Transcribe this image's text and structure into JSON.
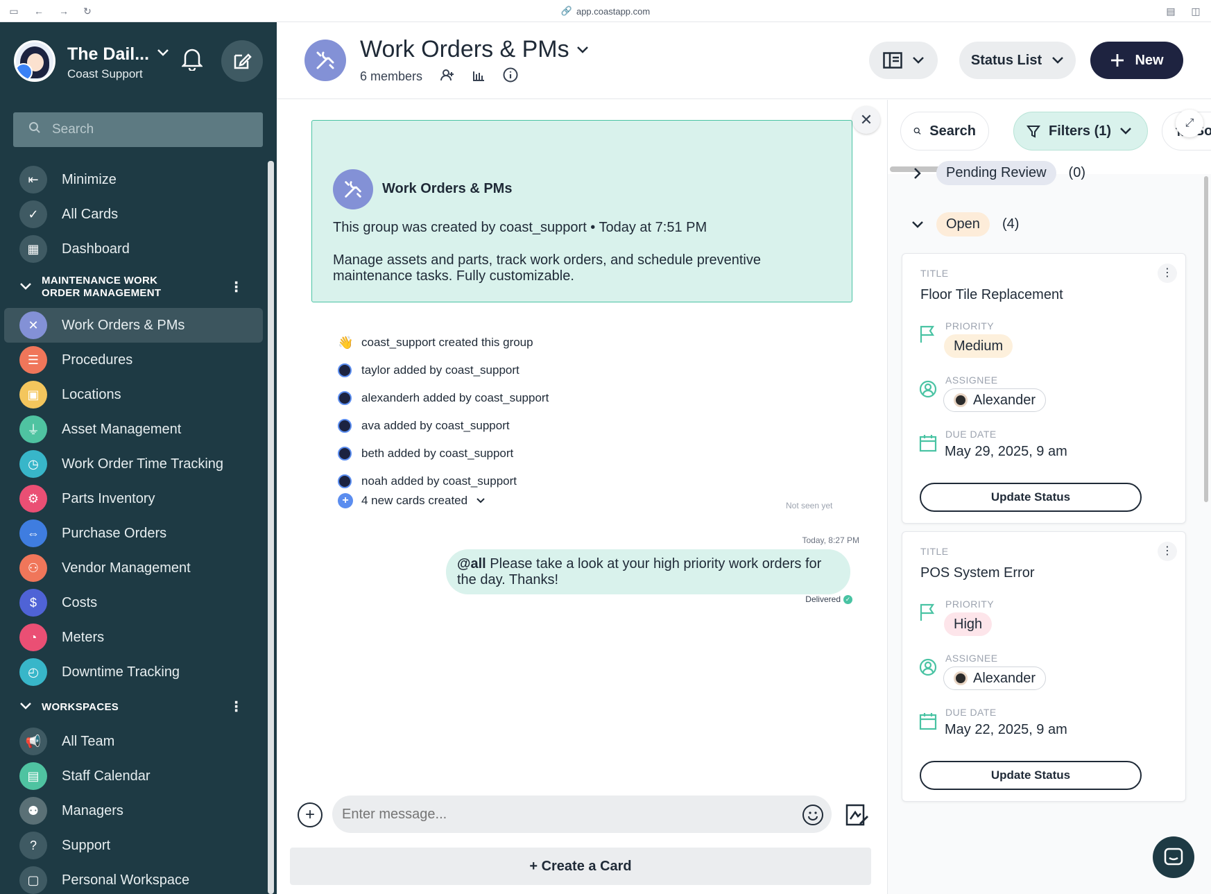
{
  "browser": {
    "url": "app.coastapp.com"
  },
  "sidebar": {
    "workspace_name": "The Dail...",
    "workspace_sub": "Coast Support",
    "search_placeholder": "Search",
    "top_items": [
      {
        "label": "Minimize",
        "icon": "minimize-icon",
        "color": "#3f5a63"
      },
      {
        "label": "All Cards",
        "icon": "check-circle-icon",
        "color": "#3f5a63"
      },
      {
        "label": "Dashboard",
        "icon": "grid-icon",
        "color": "#3f5a63"
      }
    ],
    "section1": "MAINTENANCE WORK ORDER MANAGEMENT",
    "section1_items": [
      {
        "label": "Work Orders & PMs",
        "icon": "tools-icon",
        "color": "#8391d6"
      },
      {
        "label": "Procedures",
        "icon": "list-icon",
        "color": "#f0765a"
      },
      {
        "label": "Locations",
        "icon": "building-icon",
        "color": "#f4c65d"
      },
      {
        "label": "Asset Management",
        "icon": "plug-icon",
        "color": "#4fc3a1"
      },
      {
        "label": "Work Order Time Tracking",
        "icon": "clock-icon",
        "color": "#38b6c9"
      },
      {
        "label": "Parts Inventory",
        "icon": "gear-icon",
        "color": "#ea4f74"
      },
      {
        "label": "Purchase Orders",
        "icon": "arrows-icon",
        "color": "#3f7de0"
      },
      {
        "label": "Vendor Management",
        "icon": "people-icon",
        "color": "#f0765a"
      },
      {
        "label": "Costs",
        "icon": "dollar-icon",
        "color": "#4f63d6"
      },
      {
        "label": "Meters",
        "icon": "gauge-icon",
        "color": "#ea4f74"
      },
      {
        "label": "Downtime Tracking",
        "icon": "timer-icon",
        "color": "#38b6c9"
      }
    ],
    "section2": "WORKSPACES",
    "section2_items": [
      {
        "label": "All Team",
        "icon": "megaphone-icon",
        "color": "#3f5a63"
      },
      {
        "label": "Staff Calendar",
        "icon": "calendar-icon",
        "color": "#4fc3a1"
      },
      {
        "label": "Managers",
        "icon": "group-icon",
        "color": "#5a7076"
      },
      {
        "label": "Support",
        "icon": "question-icon",
        "color": "#3f5a63"
      },
      {
        "label": "Personal Workspace",
        "icon": "box-icon",
        "color": "#3f5a63"
      }
    ]
  },
  "header": {
    "title": "Work Orders & PMs",
    "members": "6 members",
    "status_list": "Status List",
    "new_label": "New"
  },
  "chat": {
    "intro_name": "Work Orders & PMs",
    "intro_created": "This group was created by coast_support • Today at 7:51 PM",
    "intro_desc": "Manage assets and parts, track work orders, and schedule preventive maintenance tasks. Fully customizable.",
    "events": [
      "coast_support created this group",
      "taylor added by coast_support",
      "alexanderh added by coast_support",
      "ava added by coast_support",
      "beth added by coast_support",
      "noah added by coast_support"
    ],
    "new_cards": "4 new cards created",
    "not_seen": "Not seen yet",
    "msg_time": "Today, 8:27 PM",
    "msg_mention": "@all",
    "msg_text": " Please take a look at your high priority work orders for the day. Thanks!",
    "delivered": "Delivered",
    "composer_placeholder": "Enter message...",
    "create_card": "+ Create a Card"
  },
  "right_panel": {
    "search": "Search",
    "filters": "Filters (1)",
    "sort_partial": "So",
    "groups": [
      {
        "label": "Pending Review",
        "count": "(0)",
        "color": "#e4e7f0"
      },
      {
        "label": "Open",
        "count": "(4)",
        "color": "#fdecd9"
      }
    ],
    "cards": [
      {
        "title_label": "TITLE",
        "title": "Floor Tile Replacement",
        "priority_label": "PRIORITY",
        "priority": "Medium",
        "priority_color": "#fdf0dc",
        "assignee_label": "ASSIGNEE",
        "assignee": "Alexander",
        "due_label": "DUE DATE",
        "due": "May 29, 2025, 9 am",
        "button": "Update Status"
      },
      {
        "title_label": "TITLE",
        "title": "POS System Error",
        "priority_label": "PRIORITY",
        "priority": "High",
        "priority_color": "#fde5ea",
        "assignee_label": "ASSIGNEE",
        "assignee": "Alexander",
        "due_label": "DUE DATE",
        "due": "May 22, 2025, 9 am",
        "button": "Update Status"
      }
    ]
  }
}
